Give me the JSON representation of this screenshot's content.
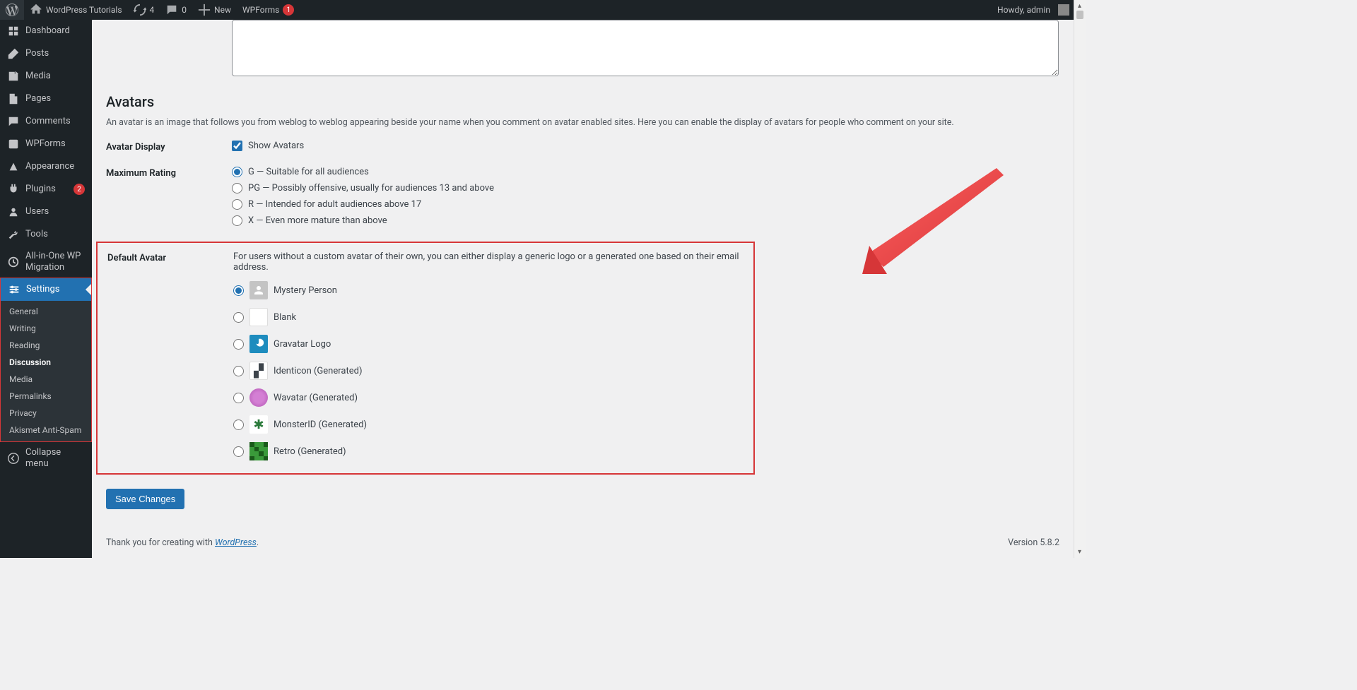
{
  "toolbar": {
    "site_name": "WordPress Tutorials",
    "updates_count": "4",
    "comments_count": "0",
    "new_label": "New",
    "wpforms_label": "WPForms",
    "wpforms_badge": "1",
    "howdy": "Howdy, admin"
  },
  "sidebar": {
    "items": [
      {
        "label": "Dashboard"
      },
      {
        "label": "Posts"
      },
      {
        "label": "Media"
      },
      {
        "label": "Pages"
      },
      {
        "label": "Comments"
      },
      {
        "label": "WPForms"
      },
      {
        "label": "Appearance"
      },
      {
        "label": "Plugins",
        "badge": "2"
      },
      {
        "label": "Users"
      },
      {
        "label": "Tools"
      },
      {
        "label": "All-in-One WP Migration"
      },
      {
        "label": "Settings",
        "active": true
      }
    ],
    "settings_submenu": [
      "General",
      "Writing",
      "Reading",
      "Discussion",
      "Media",
      "Permalinks",
      "Privacy",
      "Akismet Anti-Spam"
    ],
    "collapse_label": "Collapse menu"
  },
  "avatars": {
    "heading": "Avatars",
    "description": "An avatar is an image that follows you from weblog to weblog appearing beside your name when you comment on avatar enabled sites. Here you can enable the display of avatars for people who comment on your site.",
    "display_label": "Avatar Display",
    "show_avatars_label": "Show Avatars",
    "rating_label": "Maximum Rating",
    "ratings": [
      "G — Suitable for all audiences",
      "PG — Possibly offensive, usually for audiences 13 and above",
      "R — Intended for adult audiences above 17",
      "X — Even more mature than above"
    ],
    "default_label": "Default Avatar",
    "default_desc": "For users without a custom avatar of their own, you can either display a generic logo or a generated one based on their email address.",
    "defaults": [
      "Mystery Person",
      "Blank",
      "Gravatar Logo",
      "Identicon (Generated)",
      "Wavatar (Generated)",
      "MonsterID (Generated)",
      "Retro (Generated)"
    ]
  },
  "save_button": "Save Changes",
  "footer": {
    "thanks_prefix": "Thank you for creating with ",
    "wordpress_link": "WordPress",
    "version": "Version 5.8.2"
  }
}
